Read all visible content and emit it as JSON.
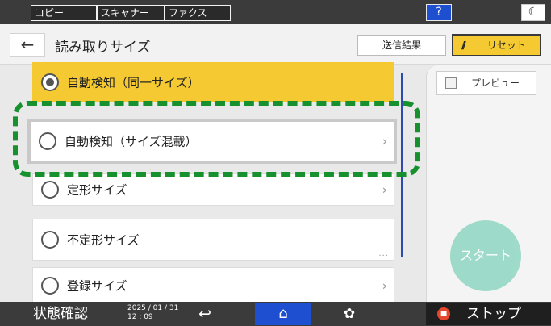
{
  "topbar": {
    "tabs": [
      "コピー",
      "スキャナー",
      "ファクス"
    ],
    "help_label": "?",
    "night_label": "☾"
  },
  "header": {
    "back_label": "←",
    "title": "読み取りサイズ",
    "result_label": "送信結果",
    "reset_icon": "//",
    "reset_label": "リセット"
  },
  "list": {
    "items": [
      {
        "label": "自動検知（同一サイズ）",
        "selected": true
      },
      {
        "label": "自動検知（サイズ混載）",
        "chevron": "›"
      },
      {
        "label": "定形サイズ",
        "chevron": "›"
      },
      {
        "label": "不定形サイズ",
        "more": "..."
      },
      {
        "label": "登録サイズ",
        "chevron": "›"
      }
    ]
  },
  "side": {
    "preview_label": "プレビュー",
    "start_label": "スタート"
  },
  "bottombar": {
    "status_label": "状態確認",
    "date": "2025 / 01 / 31",
    "time": "12 : 09",
    "back_icon": "↩",
    "home_icon": "⌂",
    "settings_icon": "✿",
    "stop_label": "ストップ"
  },
  "colors": {
    "accent_yellow": "#f4c932",
    "home_blue": "#1d4fd0",
    "highlight_green": "#16912d",
    "start_teal": "#8fd6c2",
    "stop_red": "#e6452e"
  }
}
